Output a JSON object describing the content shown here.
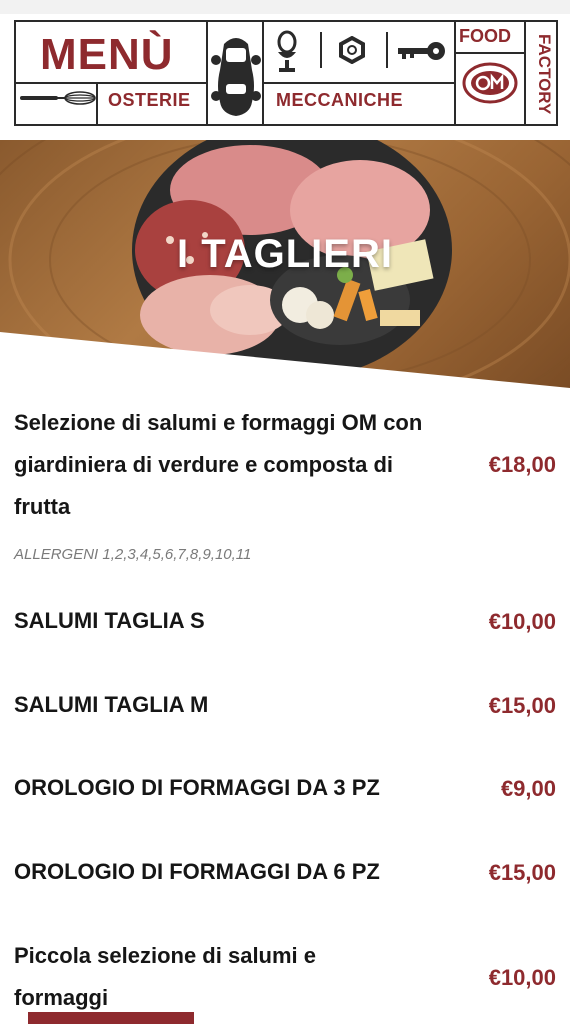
{
  "header": {
    "title": "MENÙ",
    "subtitle_left": "OSTERIE",
    "subtitle_right": "MECCANICHE",
    "food": "FOOD",
    "factory": "FACTORY"
  },
  "hero": {
    "title": "I TAGLIERI"
  },
  "items": [
    {
      "name": "Selezione di salumi e formaggi OM con giardiniera di verdure e composta di frutta",
      "price": "€18,00"
    },
    {
      "name": "SALUMI TAGLIA S",
      "price": "€10,00"
    },
    {
      "name": "SALUMI TAGLIA M",
      "price": "€15,00"
    },
    {
      "name": "OROLOGIO DI FORMAGGI DA 3 PZ",
      "price": "€9,00"
    },
    {
      "name": "OROLOGIO DI FORMAGGI DA 6 PZ",
      "price": "€15,00"
    },
    {
      "name": "Piccola selezione di salumi e formaggi",
      "price": "€10,00"
    }
  ],
  "allergens": "ALLERGENI 1,2,3,4,5,6,7,8,9,10,11",
  "colors": {
    "accent": "#8e2a2e",
    "text": "#161616",
    "muted": "#7a7a7a"
  },
  "icons": [
    "whisk-icon",
    "car-icon",
    "egg-cup-icon",
    "nut-icon",
    "key-icon",
    "om-logo-icon"
  ]
}
